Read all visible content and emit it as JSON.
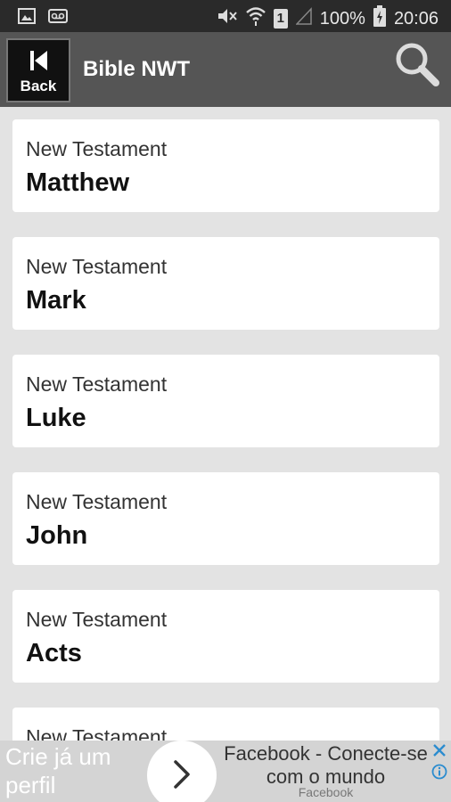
{
  "status_bar": {
    "battery_percent": "100%",
    "sim_slot": "1",
    "time": "20:06"
  },
  "app_bar": {
    "back_label": "Back",
    "title": "Bible NWT"
  },
  "books": [
    {
      "testament": "New Testament",
      "name": "Matthew"
    },
    {
      "testament": "New Testament",
      "name": "Mark"
    },
    {
      "testament": "New Testament",
      "name": "Luke"
    },
    {
      "testament": "New Testament",
      "name": "John"
    },
    {
      "testament": "New Testament",
      "name": "Acts"
    },
    {
      "testament": "New Testament",
      "name": ""
    }
  ],
  "ad": {
    "left_text": "Crie já um perfil",
    "headline": "Facebook - Conecte-se com o mundo",
    "source": "Facebook"
  },
  "colors": {
    "status_bar_bg": "#2a2a2a",
    "app_bar_bg": "#555555",
    "list_bg": "#e3e3e3",
    "card_bg": "#ffffff",
    "ad_bg": "#d4d4d4",
    "ad_icon_blue": "#2b8ccf"
  }
}
